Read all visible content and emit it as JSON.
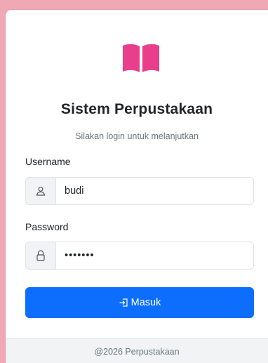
{
  "app": {
    "title": "Sistem Perpustakaan",
    "subtitle": "Silakan login untuk melanjutkan",
    "logo_icon": "book-open-icon",
    "brand_color": "#e83e8c"
  },
  "form": {
    "username": {
      "label": "Username",
      "value": "budi",
      "icon": "user-icon"
    },
    "password": {
      "label": "Password",
      "value": "•••••••",
      "icon": "lock-icon"
    },
    "submit": {
      "label": "Masuk",
      "icon": "login-icon",
      "color": "#0d6efd"
    }
  },
  "footer": {
    "text": "@2026 Perpustakaan"
  }
}
